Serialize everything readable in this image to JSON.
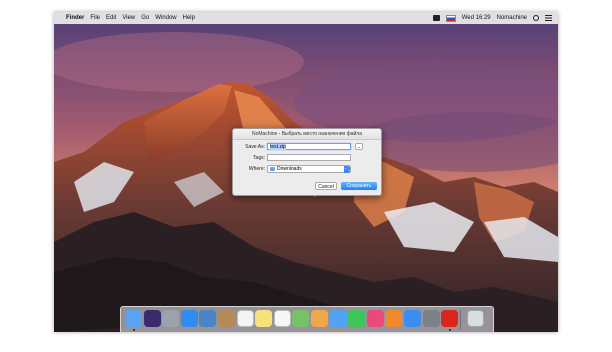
{
  "menubar": {
    "apple": "",
    "app_name": "Finder",
    "menus": [
      "File",
      "Edit",
      "View",
      "Go",
      "Window",
      "Help"
    ],
    "clock": "Wed 16:29",
    "user": "Nomachine"
  },
  "dialog": {
    "title": "NoMachine - Выбрать место назначения файла",
    "save_as_label": "Save As:",
    "save_as_value": "test.zip",
    "tags_label": "Tags:",
    "tags_value": "",
    "where_label": "Where:",
    "where_value": "Downloads",
    "expand_glyph": "⌄",
    "popup_glyph": "⌃⌄",
    "cancel_label": "Cancel",
    "save_label": "Сохранить"
  },
  "dock": {
    "apps": [
      {
        "name": "finder-icon",
        "color": "#5aa2f2",
        "running": true
      },
      {
        "name": "siri-icon",
        "color": "#3b2a6e",
        "running": false
      },
      {
        "name": "launchpad-icon",
        "color": "#9aa3ad",
        "running": false
      },
      {
        "name": "safari-icon",
        "color": "#2f8cf0",
        "running": false
      },
      {
        "name": "mail-icon",
        "color": "#4a85c8",
        "running": false
      },
      {
        "name": "contacts-icon",
        "color": "#b48a5a",
        "running": false
      },
      {
        "name": "calendar-icon",
        "color": "#f4f4f4",
        "running": false
      },
      {
        "name": "notes-icon",
        "color": "#f6e27a",
        "running": false
      },
      {
        "name": "reminders-icon",
        "color": "#f7f7f7",
        "running": false
      },
      {
        "name": "maps-icon",
        "color": "#79c06a",
        "running": false
      },
      {
        "name": "photos-icon",
        "color": "#f0a74a",
        "running": false
      },
      {
        "name": "messages-icon",
        "color": "#4fa3f5",
        "running": false
      },
      {
        "name": "facetime-icon",
        "color": "#3cc65c",
        "running": false
      },
      {
        "name": "itunes-icon",
        "color": "#e84a7c",
        "running": false
      },
      {
        "name": "ibooks-icon",
        "color": "#f08a2a",
        "running": false
      },
      {
        "name": "app-store-icon",
        "color": "#3a8df2",
        "running": false
      },
      {
        "name": "system-preferences-icon",
        "color": "#7d8085",
        "running": false
      },
      {
        "name": "nomachine-icon",
        "color": "#d9261c",
        "running": true
      }
    ],
    "trash": {
      "name": "trash-icon",
      "color": "#d8dde2"
    }
  }
}
